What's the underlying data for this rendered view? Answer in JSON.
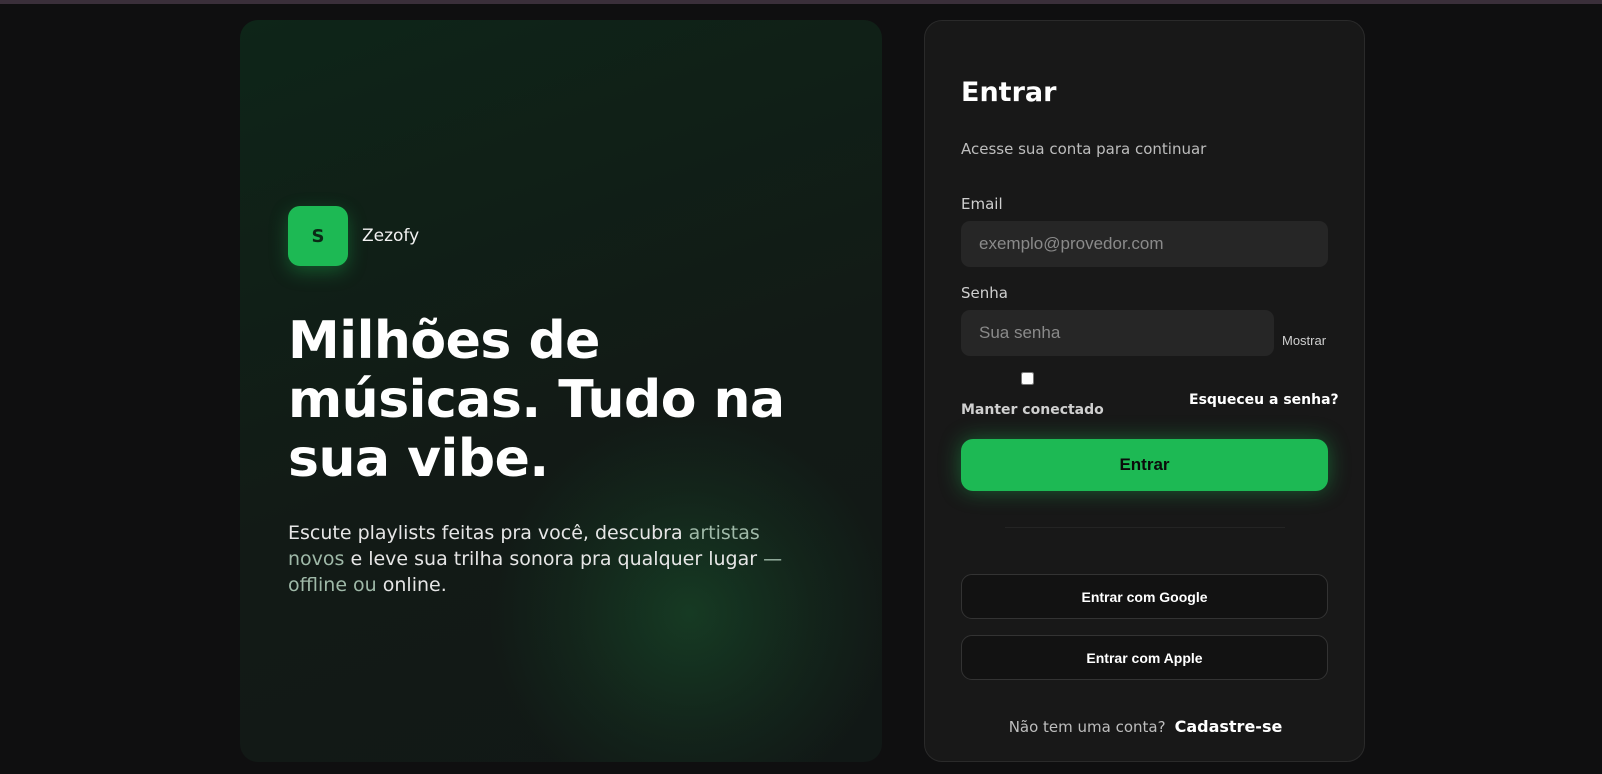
{
  "hero": {
    "brand_initial": "S",
    "brand_name": "Zezofy",
    "headline": "Milhões de músicas. Tudo na sua vibe.",
    "subtext_main": "Escute playlists feitas pra você, descubra ",
    "subtext_fade1": "artistas novos",
    "subtext_mid": " e leve sua trilha sonora pra qualquer lugar ",
    "subtext_fade2": "— offline ou",
    "subtext_end": " online."
  },
  "login": {
    "title": "Entrar",
    "subtitle": "Acesse sua conta para continuar",
    "email_label": "Email",
    "email_placeholder": "exemplo@provedor.com",
    "email_value": "",
    "password_label": "Senha",
    "password_placeholder": "Sua senha",
    "password_value": "",
    "show_label": "Mostrar",
    "remember_label": "Manter conectado",
    "remember_checked": false,
    "forgot_label": "Esqueceu a senha?",
    "submit_label": "Entrar",
    "google_label": "Entrar com Google",
    "apple_label": "Entrar com Apple",
    "no_account_text": "Não tem uma conta?",
    "signup_label": "Cadastre-se"
  },
  "colors": {
    "accent": "#1db954",
    "background": "#0f0f10",
    "card": "#181818",
    "input": "#262626"
  }
}
